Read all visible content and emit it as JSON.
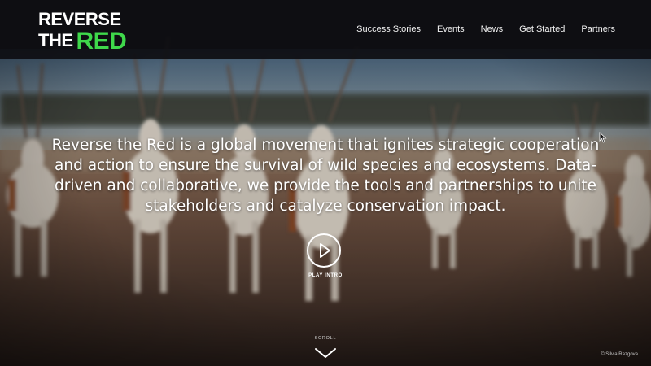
{
  "logo": {
    "line1": "REVERSE",
    "line2_the": "THE",
    "line2_red": "RED"
  },
  "nav": {
    "items": [
      "Success Stories",
      "Events",
      "News",
      "Get Started",
      "Partners"
    ]
  },
  "hero": {
    "tagline": "Reverse the Red is a global movement that ignites strategic cooperation and action to ensure the survival of wild species and ecosystems. Data-driven and collaborative, we provide the tools and partnerships to unite stakeholders and catalyze conservation impact.",
    "play_label": "PLAY INTRO",
    "scroll_label": "SCROLL",
    "photo_credit": "© Silvia Razgova"
  },
  "icons": {
    "play": "play-icon",
    "scroll": "chevron-down-icon",
    "cursor": "mouse-cursor-icon"
  },
  "colors": {
    "accent_green": "#3fd84b",
    "topbar": "#0e0e12",
    "text": "#ffffff"
  }
}
